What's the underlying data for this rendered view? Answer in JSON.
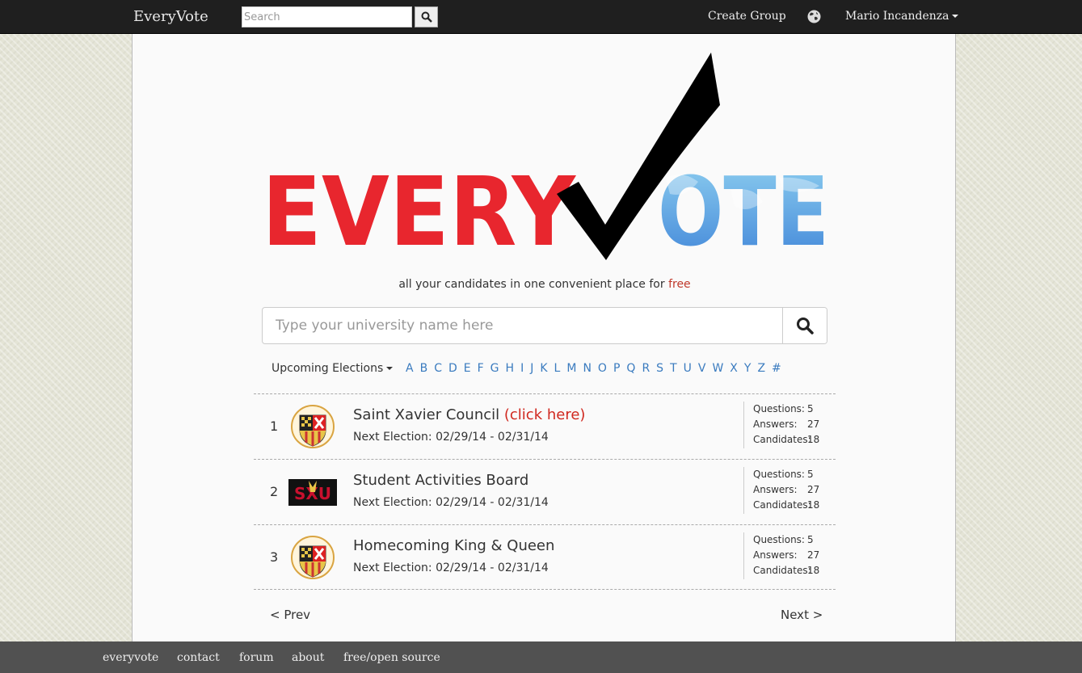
{
  "navbar": {
    "brand": "EveryVote",
    "search_placeholder": "Search",
    "create_group": "Create Group",
    "user_name": "Mario Incandenza"
  },
  "hero": {
    "logo_left_text": "EVERY",
    "logo_right_text": "OTE",
    "tagline_prefix": "all your candidates in one convenient place for ",
    "tagline_highlight": "free",
    "search_placeholder": "Type your university name here"
  },
  "filter": {
    "dropdown_label": "Upcoming Elections",
    "letters": [
      "A",
      "B",
      "C",
      "D",
      "E",
      "F",
      "G",
      "H",
      "I",
      "J",
      "K",
      "L",
      "M",
      "N",
      "O",
      "P",
      "Q",
      "R",
      "S",
      "T",
      "U",
      "V",
      "W",
      "X",
      "Y",
      "Z",
      "#"
    ]
  },
  "elections": [
    {
      "num": "1",
      "name": "Saint Xavier Council",
      "link": "(click here)",
      "next": "Next Election: 02/29/14 - 02/31/14",
      "questions_label": "Questions:",
      "questions": "5",
      "answers_label": "Answers:",
      "answers": "27",
      "candidates_label": "Candidates:",
      "candidates": "18",
      "logo": "crest"
    },
    {
      "num": "2",
      "name": "Student Activities Board",
      "link": "",
      "next": "Next Election: 02/29/14 - 02/31/14",
      "questions_label": "Questions:",
      "questions": "5",
      "answers_label": "Answers:",
      "answers": "27",
      "candidates_label": "Candidates:",
      "candidates": "18",
      "logo": "sxu-banner"
    },
    {
      "num": "3",
      "name": "Homecoming King & Queen",
      "link": "",
      "next": "Next Election: 02/29/14 - 02/31/14",
      "questions_label": "Questions:",
      "questions": "5",
      "answers_label": "Answers:",
      "answers": "27",
      "candidates_label": "Candidates:",
      "candidates": "18",
      "logo": "crest"
    }
  ],
  "sxu_logo_text": "SXU",
  "pager": {
    "prev": "< Prev",
    "next": "Next >"
  },
  "footer": {
    "links": [
      "everyvote",
      "contact",
      "forum",
      "about",
      "free/open source"
    ]
  },
  "colors": {
    "brand_red": "#e8262e",
    "globe_blue": "#4a8fd9",
    "link_blue": "#3a7bbf",
    "highlight_red": "#d0281f"
  }
}
